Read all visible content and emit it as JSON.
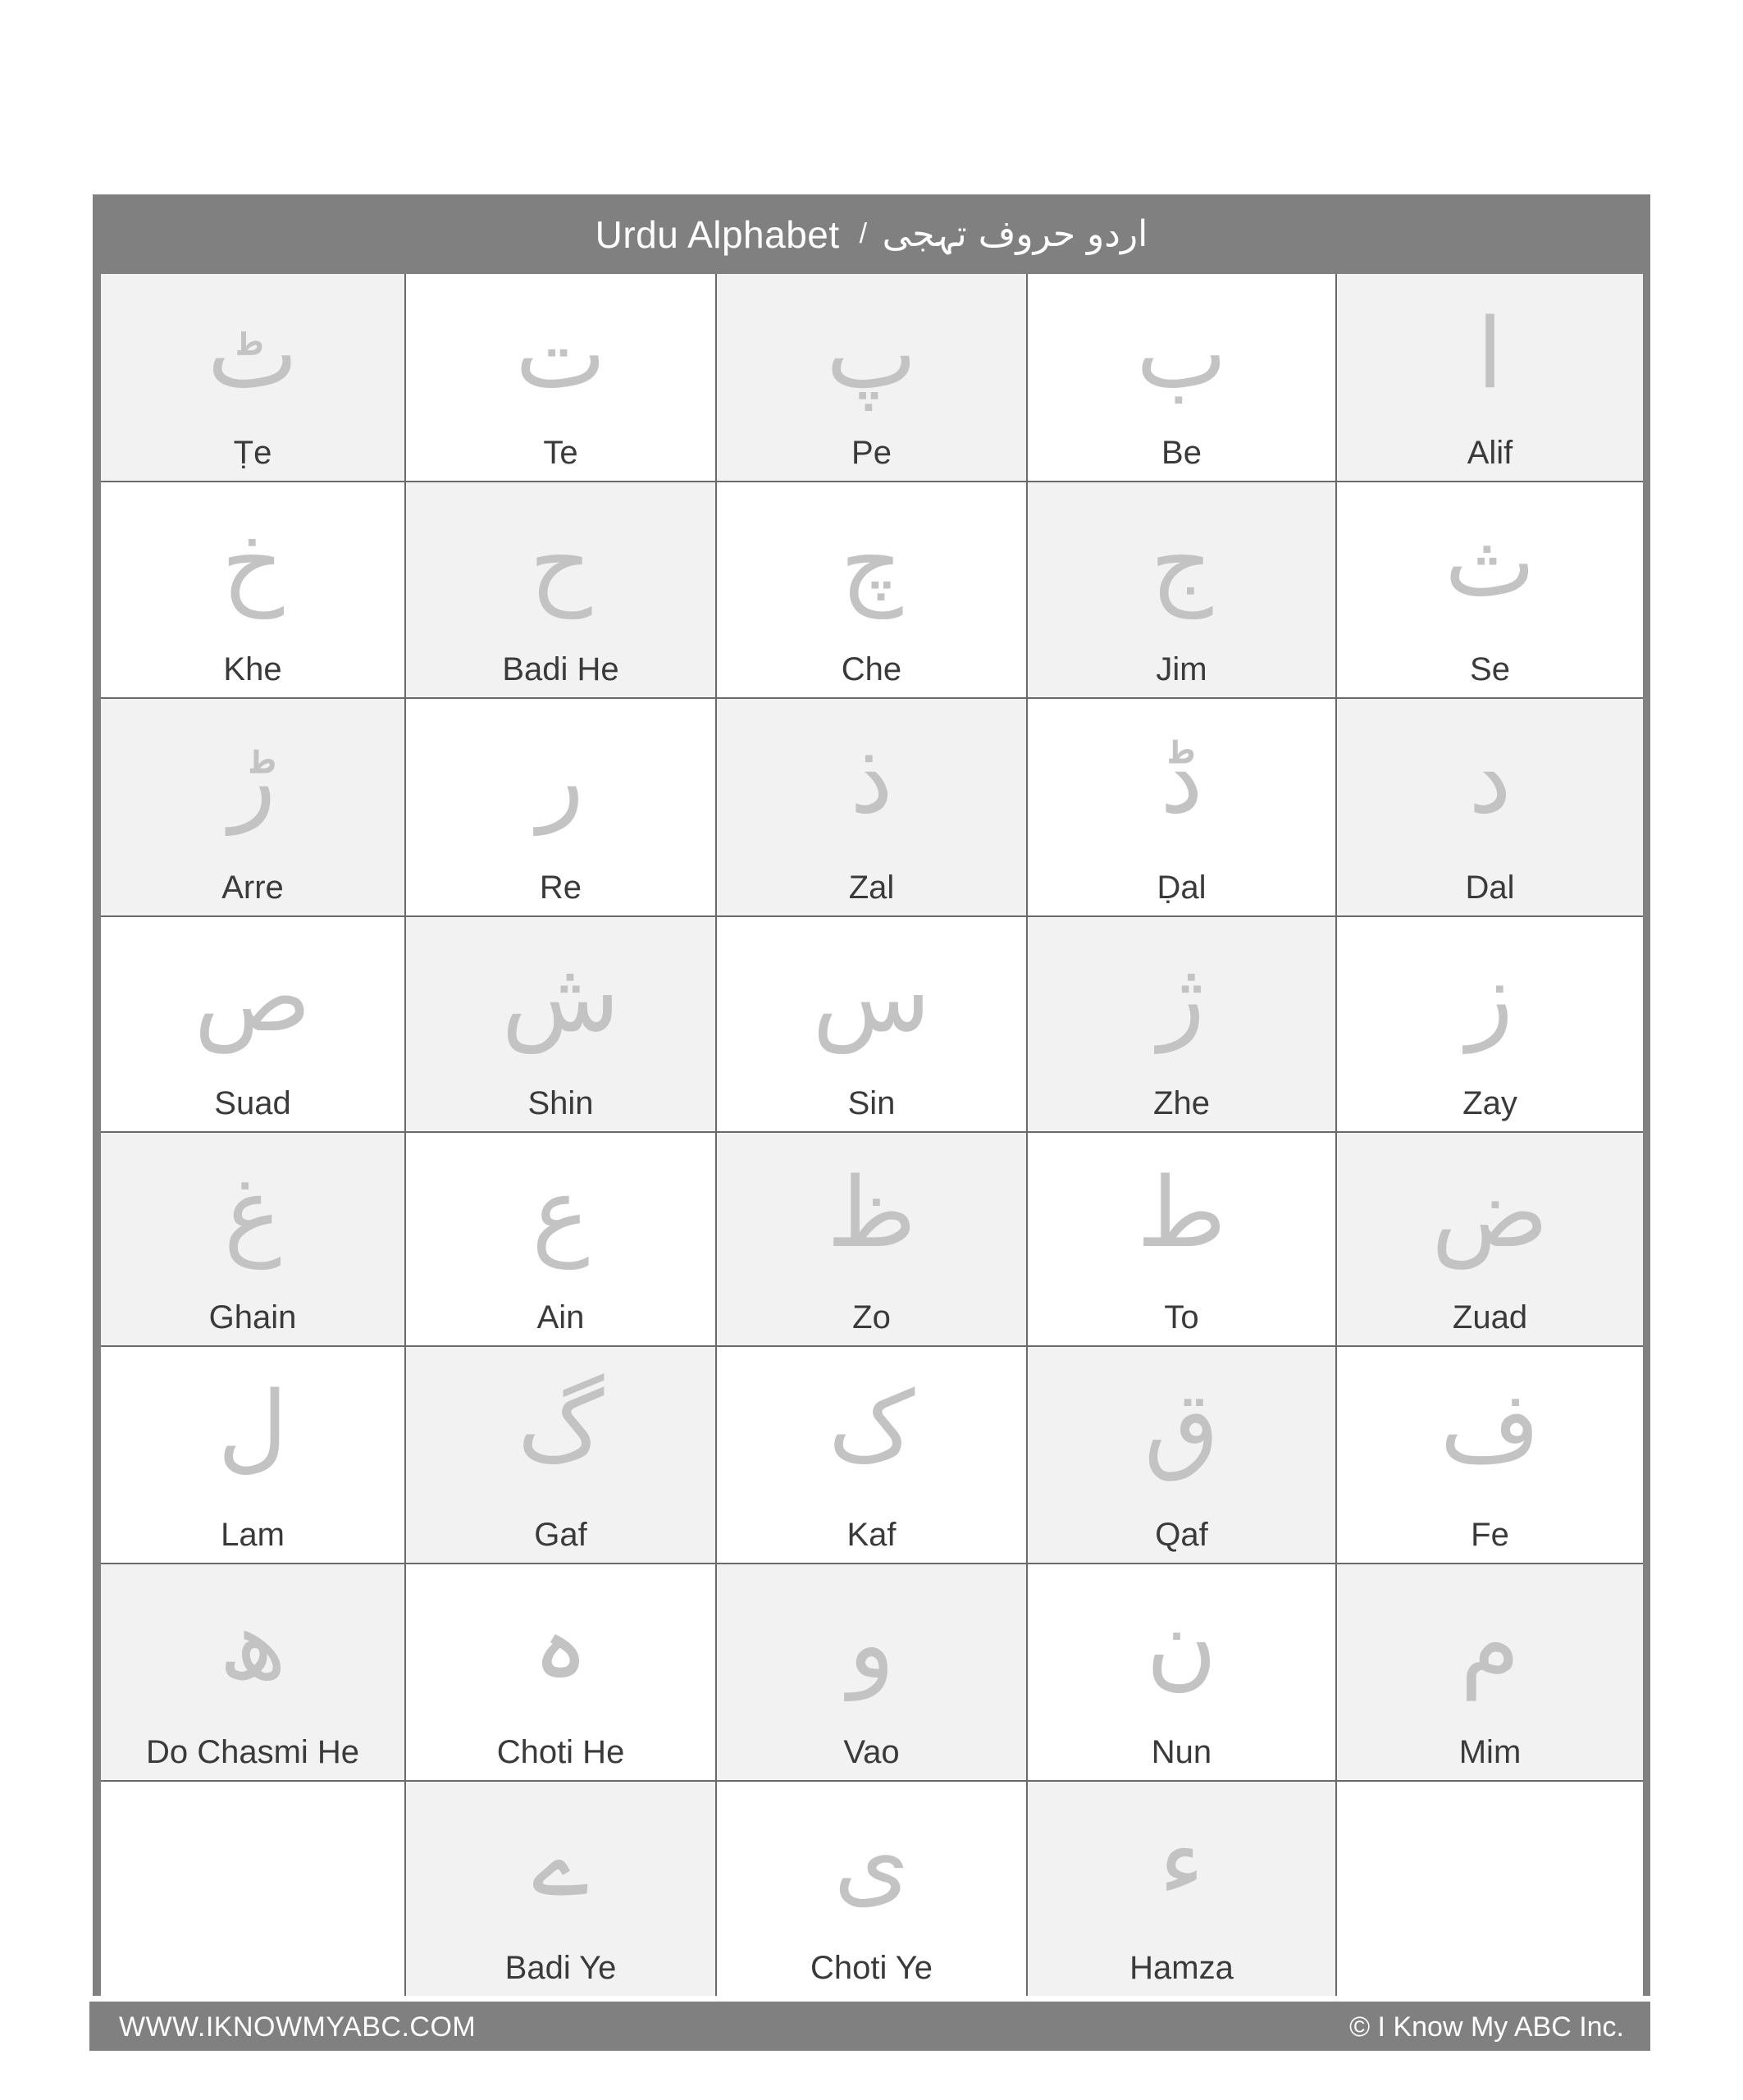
{
  "header": {
    "title_en": "Urdu Alphabet",
    "separator": "/",
    "title_ur": "اردو حروف تہجی"
  },
  "colors": {
    "frame": "#808080",
    "cell_shade": "#f2f2f2",
    "cell_white": "#ffffff",
    "letter": "#c3c3c3",
    "label": "#3a3a3a",
    "grid_line": "#6a6a6a"
  },
  "rows": [
    [
      {
        "letter": "ٹ",
        "name": "Ṭe",
        "shade": true
      },
      {
        "letter": "ت",
        "name": "Te",
        "shade": false
      },
      {
        "letter": "پ",
        "name": "Pe",
        "shade": true
      },
      {
        "letter": "ب",
        "name": "Be",
        "shade": false
      },
      {
        "letter": "ا",
        "name": "Alif",
        "shade": true
      }
    ],
    [
      {
        "letter": "خ",
        "name": "Khe",
        "shade": false
      },
      {
        "letter": "ح",
        "name": "Badi He",
        "shade": true
      },
      {
        "letter": "چ",
        "name": "Che",
        "shade": false
      },
      {
        "letter": "ج",
        "name": "Jim",
        "shade": true
      },
      {
        "letter": "ث",
        "name": "Se",
        "shade": false
      }
    ],
    [
      {
        "letter": "ڑ",
        "name": "Arre",
        "shade": true
      },
      {
        "letter": "ر",
        "name": "Re",
        "shade": false
      },
      {
        "letter": "ذ",
        "name": "Zal",
        "shade": true
      },
      {
        "letter": "ڈ",
        "name": "Ḍal",
        "shade": false
      },
      {
        "letter": "د",
        "name": "Dal",
        "shade": true
      }
    ],
    [
      {
        "letter": "ص",
        "name": "Suad",
        "shade": false
      },
      {
        "letter": "ش",
        "name": "Shin",
        "shade": true
      },
      {
        "letter": "س",
        "name": "Sin",
        "shade": false
      },
      {
        "letter": "ژ",
        "name": "Zhe",
        "shade": true
      },
      {
        "letter": "ز",
        "name": "Zay",
        "shade": false
      }
    ],
    [
      {
        "letter": "غ",
        "name": "Ghain",
        "shade": true
      },
      {
        "letter": "ع",
        "name": "Ain",
        "shade": false
      },
      {
        "letter": "ظ",
        "name": "Zo",
        "shade": true
      },
      {
        "letter": "ط",
        "name": "To",
        "shade": false
      },
      {
        "letter": "ض",
        "name": "Zuad",
        "shade": true
      }
    ],
    [
      {
        "letter": "ل",
        "name": "Lam",
        "shade": false
      },
      {
        "letter": "گ",
        "name": "Gaf",
        "shade": true
      },
      {
        "letter": "ک",
        "name": "Kaf",
        "shade": false
      },
      {
        "letter": "ق",
        "name": "Qaf",
        "shade": true
      },
      {
        "letter": "ف",
        "name": "Fe",
        "shade": false
      }
    ],
    [
      {
        "letter": "ھ",
        "name": "Do Chasmi He",
        "shade": true
      },
      {
        "letter": "ہ",
        "name": "Choti He",
        "shade": false
      },
      {
        "letter": "و",
        "name": "Vao",
        "shade": true
      },
      {
        "letter": "ن",
        "name": "Nun",
        "shade": false
      },
      {
        "letter": "م",
        "name": "Mim",
        "shade": true
      }
    ],
    [
      {
        "letter": "",
        "name": "",
        "shade": false
      },
      {
        "letter": "ے",
        "name": "Badi Ye",
        "shade": true
      },
      {
        "letter": "ی",
        "name": "Choti Ye",
        "shade": false
      },
      {
        "letter": "ء",
        "name": "Hamza",
        "shade": true
      },
      {
        "letter": "",
        "name": "",
        "shade": false
      }
    ]
  ],
  "footer": {
    "website": "WWW.IKNOWMYABC.COM",
    "copyright": "© I Know My ABC Inc."
  }
}
